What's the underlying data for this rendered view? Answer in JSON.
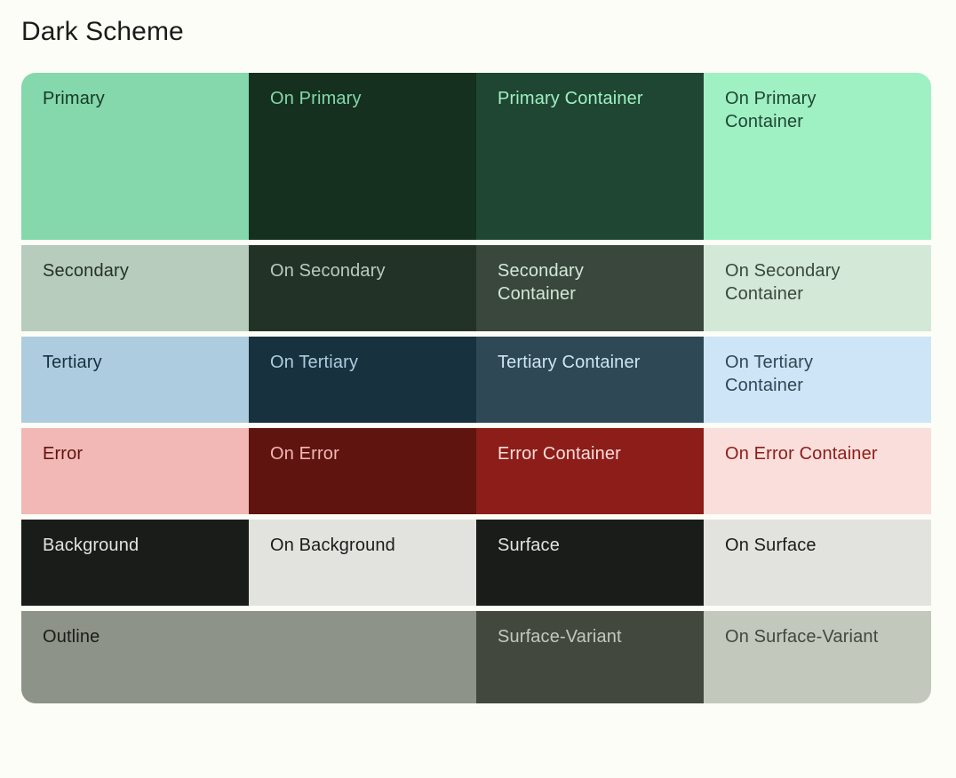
{
  "page": {
    "title": "Dark Scheme",
    "background_color": "#fcfdf6",
    "title_color": "#1a1c19",
    "card_radius": "16px"
  },
  "scheme": {
    "name": "Dark Scheme",
    "rows": [
      {
        "id": "primary-row",
        "height": "tall",
        "cells": [
          {
            "id": "primary",
            "label": "Primary",
            "bg": "#84d8ab",
            "fg": "#173827",
            "span": 1
          },
          {
            "id": "on-primary",
            "label": "On Primary",
            "bg": "#15301f",
            "fg": "#84d8ab",
            "span": 1
          },
          {
            "id": "primary-container",
            "label": "Primary Container",
            "bg": "#1f4632",
            "fg": "#9ff0c3",
            "span": 1
          },
          {
            "id": "on-primary-container",
            "label": "On Primary\nContainer",
            "bg": "#9ff0c3",
            "fg": "#1f4632",
            "span": 1
          }
        ]
      },
      {
        "id": "secondary-row",
        "height": "normal",
        "cells": [
          {
            "id": "secondary",
            "label": "Secondary",
            "bg": "#b8ccbe",
            "fg": "#233227",
            "span": 1
          },
          {
            "id": "on-secondary",
            "label": "On Secondary",
            "bg": "#233227",
            "fg": "#b8ccbe",
            "span": 1
          },
          {
            "id": "secondary-container",
            "label": "Secondary\nContainer",
            "bg": "#39473c",
            "fg": "#d3e8d7",
            "span": 1
          },
          {
            "id": "on-secondary-container",
            "label": "On Secondary\nContainer",
            "bg": "#d3e8d7",
            "fg": "#39473c",
            "span": 1
          }
        ]
      },
      {
        "id": "tertiary-row",
        "height": "normal",
        "cells": [
          {
            "id": "tertiary",
            "label": "Tertiary",
            "bg": "#adccdf",
            "fg": "#17313f",
            "span": 1
          },
          {
            "id": "on-tertiary",
            "label": "On Tertiary",
            "bg": "#17313f",
            "fg": "#adccdf",
            "span": 1
          },
          {
            "id": "tertiary-container",
            "label": "Tertiary Container",
            "bg": "#2e4856",
            "fg": "#cde5f6",
            "span": 1
          },
          {
            "id": "on-tertiary-container",
            "label": "On Tertiary\nContainer",
            "bg": "#cde5f6",
            "fg": "#2e4856",
            "span": 1
          }
        ]
      },
      {
        "id": "error-row",
        "height": "normal",
        "cells": [
          {
            "id": "error",
            "label": "Error",
            "bg": "#f2b8b5",
            "fg": "#601410",
            "span": 1
          },
          {
            "id": "on-error",
            "label": "On Error",
            "bg": "#601410",
            "fg": "#f2b8b5",
            "span": 1
          },
          {
            "id": "error-container",
            "label": "Error Container",
            "bg": "#8c1d18",
            "fg": "#f9dedc",
            "span": 1
          },
          {
            "id": "on-error-container",
            "label": "On Error Container",
            "bg": "#f9dedc",
            "fg": "#8c1d18",
            "span": 1
          }
        ]
      },
      {
        "id": "background-row",
        "height": "normal",
        "cells": [
          {
            "id": "background",
            "label": "Background",
            "bg": "#1a1c19",
            "fg": "#e2e3de",
            "span": 1
          },
          {
            "id": "on-background",
            "label": "On Background",
            "bg": "#e2e3de",
            "fg": "#1a1c19",
            "span": 1
          },
          {
            "id": "surface",
            "label": "Surface",
            "bg": "#1a1c19",
            "fg": "#e2e3de",
            "span": 1
          },
          {
            "id": "on-surface",
            "label": "On Surface",
            "bg": "#e2e3de",
            "fg": "#1a1c19",
            "span": 1
          }
        ]
      },
      {
        "id": "outline-row",
        "height": "last",
        "cells": [
          {
            "id": "outline",
            "label": "Outline",
            "bg": "#8d9389",
            "fg": "#1a1c19",
            "span": 2
          },
          {
            "id": "surface-variant",
            "label": "Surface-Variant",
            "bg": "#43483f",
            "fg": "#c3c8bd",
            "span": 1
          },
          {
            "id": "on-surface-variant",
            "label": "On Surface-Variant",
            "bg": "#c3c8bd",
            "fg": "#43483f",
            "span": 1
          }
        ]
      }
    ]
  }
}
